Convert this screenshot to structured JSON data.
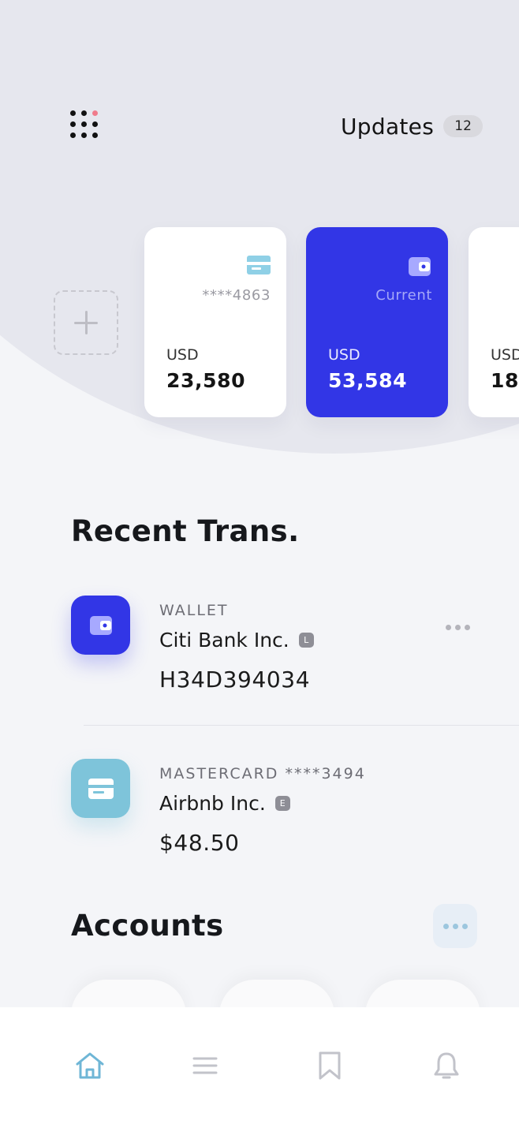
{
  "header": {
    "updates_label": "Updates",
    "updates_count": "12"
  },
  "cards": [
    {
      "sub": "****4863",
      "currency": "USD",
      "amount": "23,580",
      "icon": "credit-card-icon",
      "active": false
    },
    {
      "sub": "Current",
      "currency": "USD",
      "amount": "53,584",
      "icon": "wallet-icon",
      "active": true
    },
    {
      "sub": "",
      "currency": "USD",
      "amount": "18,",
      "icon": "",
      "active": false
    }
  ],
  "recent": {
    "title": "Recent Trans.",
    "items": [
      {
        "type": "WALLET",
        "merchant": "Citi Bank Inc.",
        "tag": "L",
        "value": "H34D394034",
        "icon": "wallet-icon"
      },
      {
        "type": "MASTERCARD ****3494",
        "merchant": "Airbnb Inc.",
        "tag": "E",
        "value": "$48.50",
        "icon": "credit-card-icon"
      }
    ]
  },
  "accounts": {
    "title": "Accounts"
  },
  "nav": {
    "items": [
      "home-icon",
      "list-icon",
      "bookmark-icon",
      "bell-icon"
    ]
  },
  "colors": {
    "primary": "#3236e6",
    "accent": "#7ec4da",
    "background": "#f4f5f8",
    "notification_dot": "#f07b8b"
  }
}
